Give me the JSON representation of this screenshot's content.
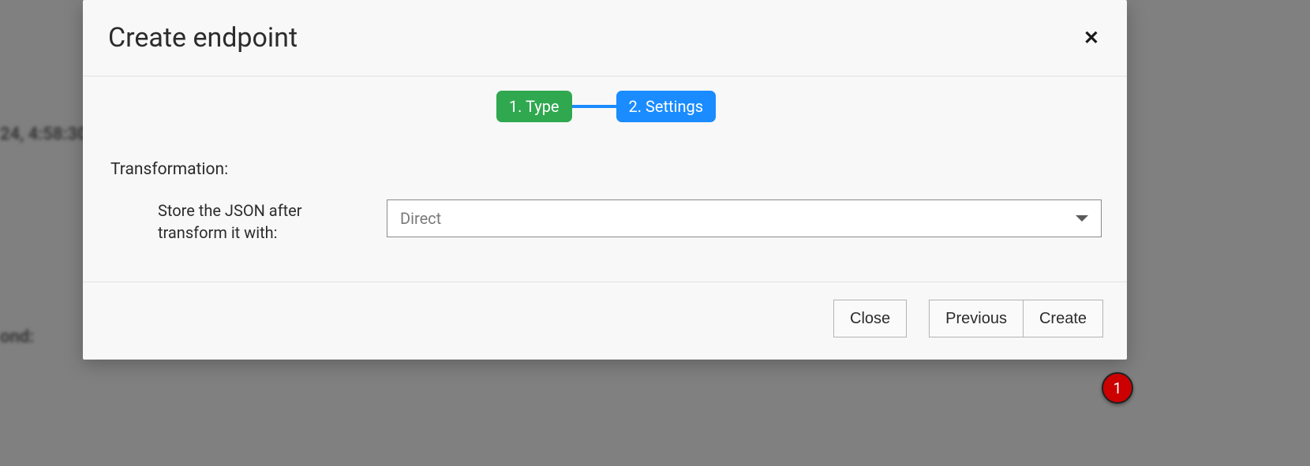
{
  "background": {
    "timestamp": "24, 4:58:30",
    "label_fragment": "ond:"
  },
  "modal": {
    "title": "Create endpoint",
    "stepper": {
      "step1": "1. Type",
      "step2": "2. Settings"
    },
    "form": {
      "section_label": "Transformation:",
      "field_label": "Store the JSON after transform it with:",
      "select_value": "Direct"
    },
    "footer": {
      "close": "Close",
      "previous": "Previous",
      "create": "Create"
    }
  },
  "annotation": {
    "badge": "1"
  }
}
